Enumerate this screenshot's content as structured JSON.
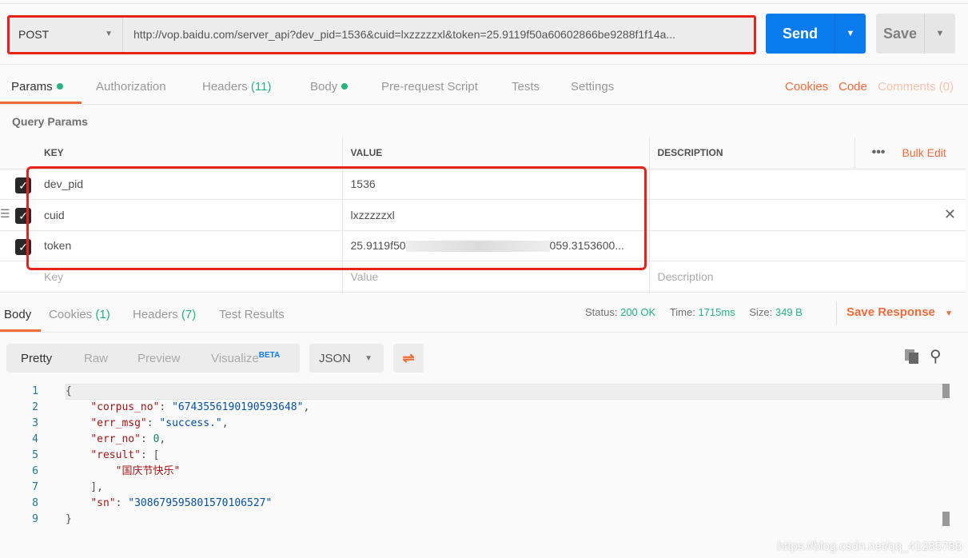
{
  "request": {
    "method": "POST",
    "url": "http://vop.baidu.com/server_api?dev_pid=1536&cuid=lxzzzzzxl&token=25.9119f50a60602866be9288f1f14a...",
    "send_label": "Send",
    "save_label": "Save"
  },
  "req_tabs": [
    {
      "label": "Params"
    },
    {
      "label": "Authorization"
    },
    {
      "label": "Headers",
      "count": "(11)"
    },
    {
      "label": "Body"
    },
    {
      "label": "Pre-request Script"
    },
    {
      "label": "Tests"
    },
    {
      "label": "Settings"
    }
  ],
  "right_links": {
    "cookies": "Cookies",
    "code": "Code",
    "comments": "Comments (0)"
  },
  "query_params": {
    "title": "Query Params",
    "headers": [
      "KEY",
      "VALUE",
      "DESCRIPTION"
    ],
    "bulk_edit": "Bulk Edit",
    "rows": [
      {
        "key": "dev_pid",
        "value": "1536",
        "checked": true
      },
      {
        "key": "cuid",
        "value": "lxzzzzzxl",
        "checked": true
      },
      {
        "key": "token",
        "value_start": "25.9119f50",
        "value_end": "059.3153600...",
        "checked": true
      }
    ],
    "placeholders": {
      "key": "Key",
      "value": "Value",
      "description": "Description"
    }
  },
  "resp_tabs": [
    {
      "label": "Body"
    },
    {
      "label": "Cookies",
      "count": "(1)"
    },
    {
      "label": "Headers",
      "count": "(7)"
    },
    {
      "label": "Test Results"
    }
  ],
  "status": {
    "status_label": "Status:",
    "status": "200 OK",
    "time_label": "Time:",
    "time": "1715ms",
    "size_label": "Size:",
    "size": "349 B",
    "save_response": "Save Response"
  },
  "view": {
    "modes": [
      "Pretty",
      "Raw",
      "Preview",
      "Visualize"
    ],
    "beta": "BETA",
    "format": "JSON"
  },
  "body_lines": [
    [
      [
        "p",
        "{"
      ]
    ],
    [
      [
        "p",
        "    "
      ],
      [
        "k",
        "\"corpus_no\""
      ],
      [
        "p",
        ": "
      ],
      [
        "s",
        "\"6743556190190593648\""
      ],
      [
        "p",
        ","
      ]
    ],
    [
      [
        "p",
        "    "
      ],
      [
        "k",
        "\"err_msg\""
      ],
      [
        "p",
        ": "
      ],
      [
        "s",
        "\"success.\""
      ],
      [
        "p",
        ","
      ]
    ],
    [
      [
        "p",
        "    "
      ],
      [
        "k",
        "\"err_no\""
      ],
      [
        "p",
        ": "
      ],
      [
        "n",
        "0"
      ],
      [
        "p",
        ","
      ]
    ],
    [
      [
        "p",
        "    "
      ],
      [
        "k",
        "\"result\""
      ],
      [
        "p",
        ": ["
      ]
    ],
    [
      [
        "p",
        "        "
      ],
      [
        "k",
        "\"国庆节快乐\""
      ]
    ],
    [
      [
        "p",
        "    ],"
      ]
    ],
    [
      [
        "p",
        "    "
      ],
      [
        "k",
        "\"sn\""
      ],
      [
        "p",
        ": "
      ],
      [
        "s",
        "\"308679595801570106527\""
      ]
    ],
    [
      [
        "p",
        "}"
      ]
    ]
  ],
  "watermark": "https://blog.csdn.net/qq_41285788"
}
